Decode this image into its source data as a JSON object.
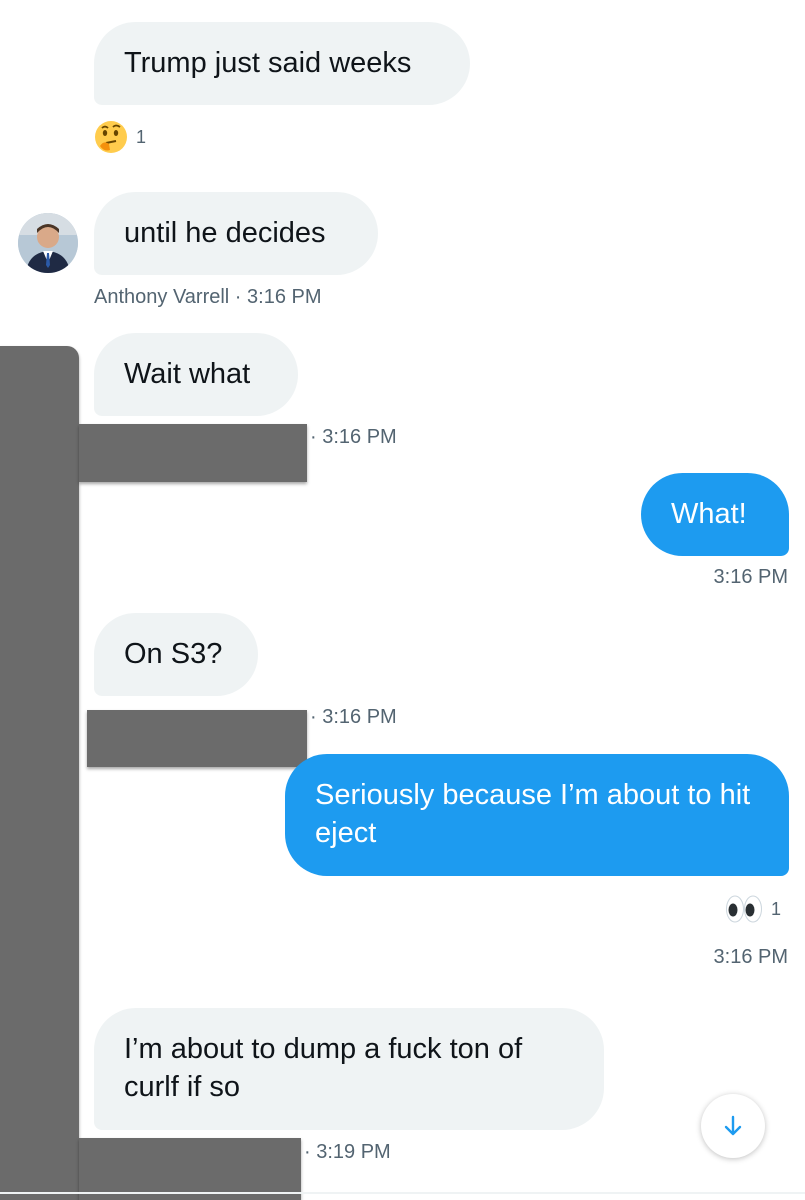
{
  "messages": [
    {
      "id": "m1",
      "text": "Trump just said weeks",
      "reaction": {
        "emoji": "thinking-face",
        "count": "1"
      }
    },
    {
      "id": "m2",
      "text": "until he decides",
      "meta": "Anthony Varrell · 3:16 PM"
    },
    {
      "id": "m3",
      "text": "Wait what",
      "meta": "· 3:16 PM"
    },
    {
      "id": "m4",
      "text": "What!",
      "meta": "3:16 PM"
    },
    {
      "id": "m5",
      "text": "On S3?",
      "meta": "· 3:16 PM"
    },
    {
      "id": "m6",
      "text": "Seriously because I’m about to hit eject",
      "reaction": {
        "emoji": "eyes",
        "count": "1"
      },
      "meta": "3:16 PM"
    },
    {
      "id": "m7",
      "text": "I’m about to dump a fuck ton of curlf if so",
      "meta": "· 3:19 PM"
    }
  ],
  "colors": {
    "accent": "#1d9bf0",
    "incoming_bg": "#eff3f4",
    "meta_text": "#536471",
    "redaction": "#6b6b6b"
  },
  "icons": {
    "avatar": "avatar",
    "scroll": "arrow-down-icon"
  }
}
